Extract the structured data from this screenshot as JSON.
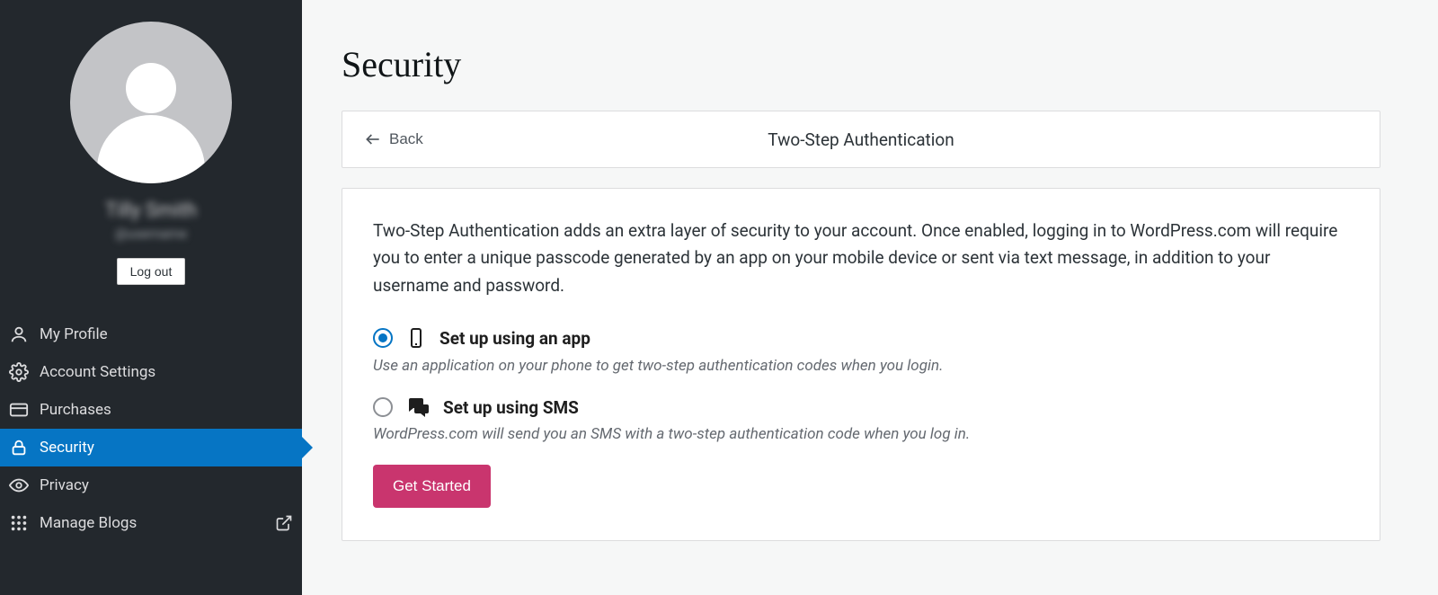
{
  "sidebar": {
    "display_name": "Tilly Smith",
    "username": "@username",
    "logout_label": "Log out",
    "items": [
      {
        "label": "My Profile",
        "icon": "person-icon"
      },
      {
        "label": "Account Settings",
        "icon": "gear-icon"
      },
      {
        "label": "Purchases",
        "icon": "card-icon"
      },
      {
        "label": "Security",
        "icon": "lock-icon"
      },
      {
        "label": "Privacy",
        "icon": "eye-icon"
      },
      {
        "label": "Manage Blogs",
        "icon": "grid-icon"
      }
    ],
    "active_index": 3
  },
  "main": {
    "page_title": "Security",
    "header": {
      "back_label": "Back",
      "title": "Two-Step Authentication"
    },
    "intro": "Two-Step Authentication adds an extra layer of security to your account. Once enabled, logging in to WordPress.com will require you to enter a unique passcode generated by an app on your mobile device or sent via text message, in addition to your username and password.",
    "options": [
      {
        "id": "app",
        "label": "Set up using an app",
        "description": "Use an application on your phone to get two-step authentication codes when you login.",
        "selected": true
      },
      {
        "id": "sms",
        "label": "Set up using SMS",
        "description": "WordPress.com will send you an SMS with a two-step authentication code when you log in.",
        "selected": false
      }
    ],
    "cta_label": "Get Started"
  }
}
